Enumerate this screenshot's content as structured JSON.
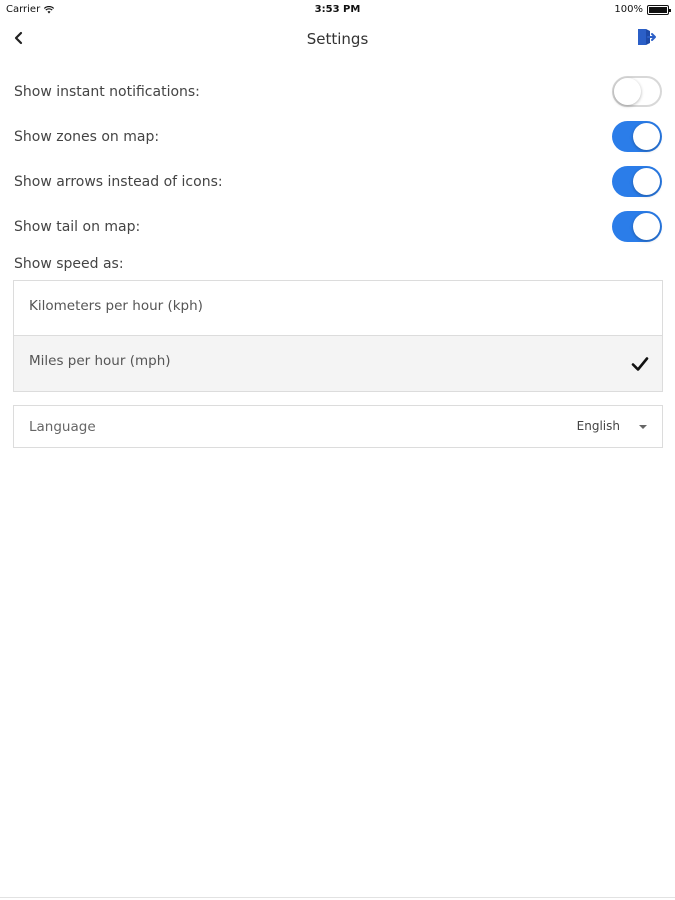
{
  "status_bar": {
    "carrier": "Carrier",
    "time": "3:53 PM",
    "battery": "100%"
  },
  "nav": {
    "title": "Settings",
    "back_icon": "chevron-left-icon",
    "logout_icon": "logout-icon",
    "accent_color": "#2b5fc7"
  },
  "settings": {
    "instant_notifications": {
      "label": "Show instant notifications:",
      "enabled": false
    },
    "zones_on_map": {
      "label": "Show zones on map:",
      "enabled": true
    },
    "arrows_instead_of_icons": {
      "label": "Show arrows instead of icons:",
      "enabled": true
    },
    "tail_on_map": {
      "label": "Show tail on map:",
      "enabled": true
    }
  },
  "speed": {
    "label": "Show speed as:",
    "options": [
      {
        "label": "Kilometers per hour (kph)",
        "selected": false
      },
      {
        "label": "Miles per hour (mph)",
        "selected": true
      }
    ]
  },
  "language": {
    "label": "Language",
    "value": "English"
  },
  "colors": {
    "toggle_on": "#2b7de9",
    "toggle_off_border": "#d8d8d8",
    "selected_row_bg": "#f4f4f4"
  }
}
